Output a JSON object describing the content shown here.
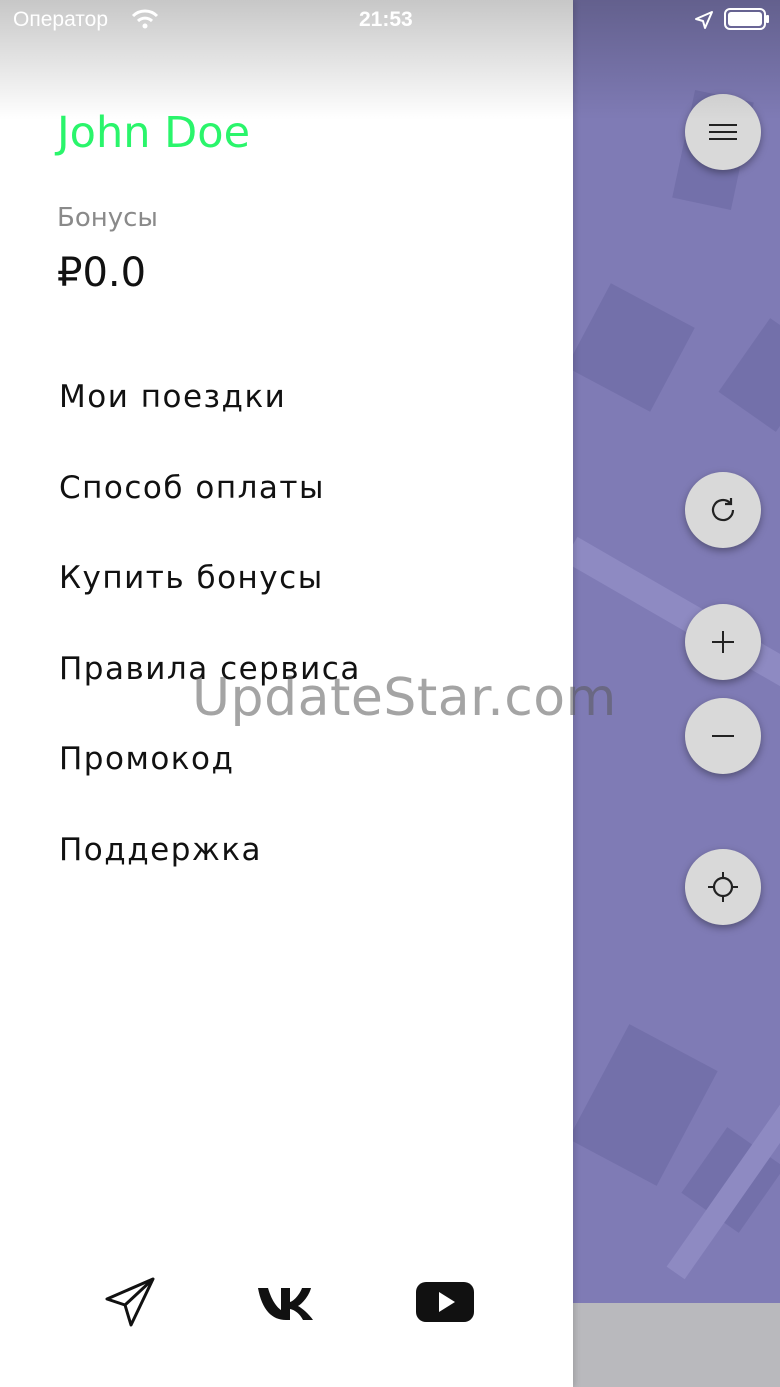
{
  "status_bar": {
    "carrier": "Оператор",
    "time": "21:53"
  },
  "drawer": {
    "user_name": "John Doe",
    "bonus_label": "Бонусы",
    "bonus_value": "₽0.0",
    "menu": [
      {
        "label": "Мои поездки"
      },
      {
        "label": "Способ оплаты"
      },
      {
        "label": "Купить бонусы"
      },
      {
        "label": "Правила сервиса"
      },
      {
        "label": "Промокод"
      },
      {
        "label": "Поддержка"
      }
    ],
    "social_icons": [
      "telegram-icon",
      "vk-icon",
      "youtube-icon"
    ]
  },
  "map_controls": [
    "menu-icon",
    "refresh-icon",
    "zoom-in-icon",
    "zoom-out-icon",
    "locate-icon"
  ],
  "watermark": "UpdateStar.com",
  "colors": {
    "user_name": "#2af56b",
    "map": "#7f7bb5",
    "fab": "#d9d9d9"
  }
}
